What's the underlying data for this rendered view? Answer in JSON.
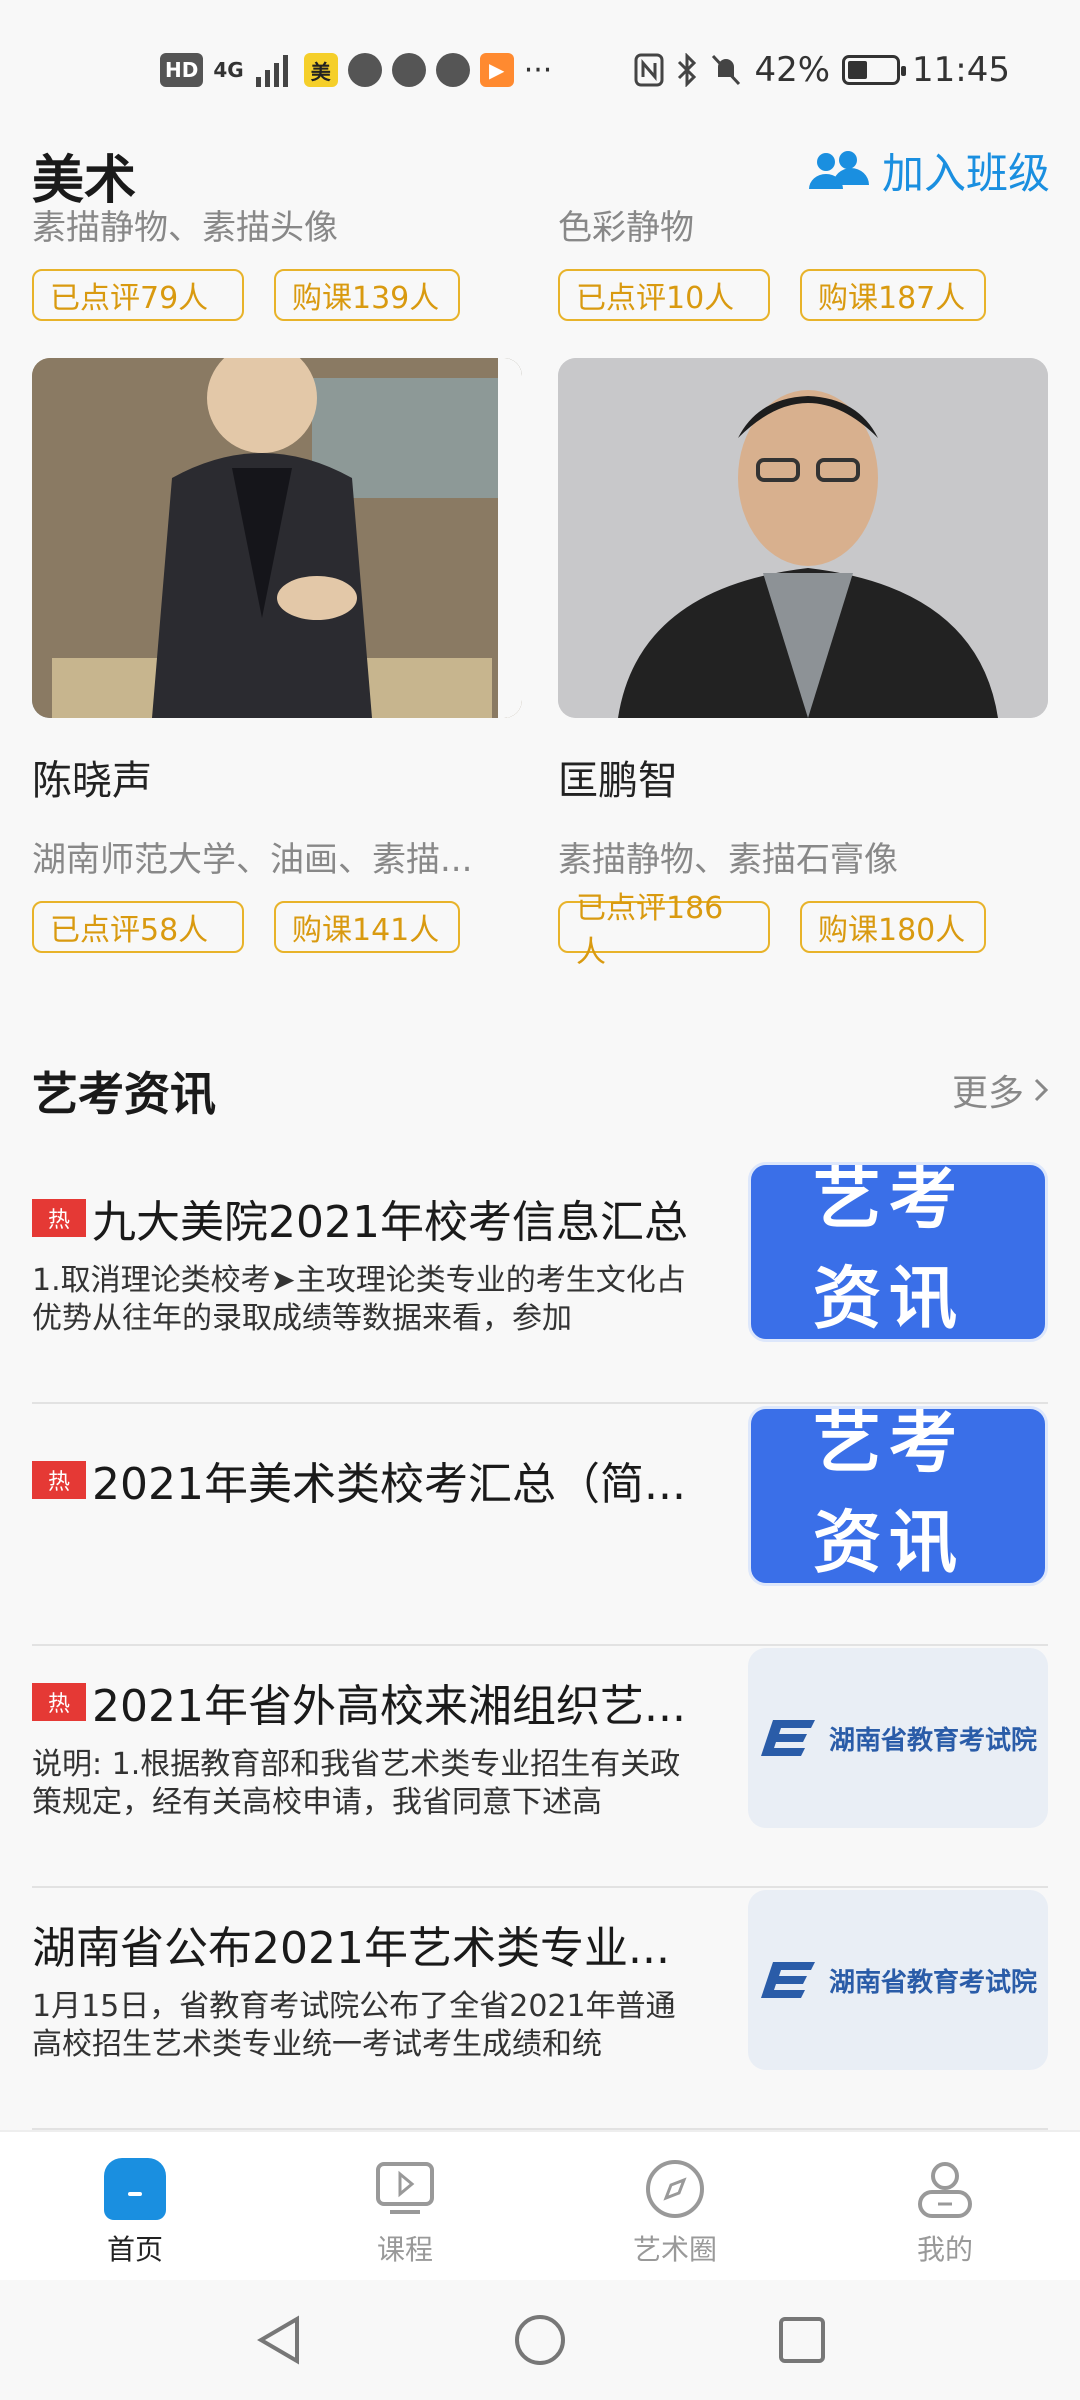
{
  "status_bar": {
    "hd": "HD",
    "net": "4G",
    "mei_app": "美",
    "more": "···",
    "battery_percent": "42%",
    "time": "11:45",
    "battery_level": 0.42
  },
  "header": {
    "section_title": "美术",
    "join_class_label": "加入班级"
  },
  "teachers": [
    {
      "name": "",
      "desc": "素描静物、素描头像",
      "reviewed": "已点评79人",
      "purchased": "购课139人"
    },
    {
      "name": "",
      "desc": "色彩静物",
      "reviewed": "已点评10人",
      "purchased": "购课187人"
    },
    {
      "name": "陈晓声",
      "desc": "湖南师范大学、油画、素描...",
      "reviewed": "已点评58人",
      "purchased": "购课141人"
    },
    {
      "name": "匡鹏智",
      "desc": "素描静物、素描石膏像",
      "reviewed": "已点评186人",
      "purchased": "购课180人"
    }
  ],
  "news": {
    "section_title": "艺考资讯",
    "more_label": "更多",
    "hot_label": "热",
    "items": [
      {
        "hot": true,
        "title": "九大美院2021年校考信息汇总",
        "summary": "1.取消理论类校考➤主攻理论类专业的考生文化占优势从往年的录取成绩等数据来看，参加",
        "thumb_line1": "艺考",
        "thumb_line2": "资讯"
      },
      {
        "hot": true,
        "title": "2021年美术类校考汇总（简...",
        "summary": "",
        "thumb_line1": "艺考",
        "thumb_line2": "资讯"
      },
      {
        "hot": true,
        "title": "2021年省外高校来湘组织艺...",
        "summary": "说明: 1.根据教育部和我省艺术类专业招生有关政策规定，经有关高校申请，我省同意下述高",
        "thumb_org": "湖南省教育考试院"
      },
      {
        "hot": false,
        "title": "湖南省公布2021年艺术类专业...",
        "summary": "1月15日，省教育考试院公布了全省2021年普通高校招生艺术类专业统一考试考生成绩和统",
        "thumb_org": "湖南省教育考试院"
      }
    ]
  },
  "bottom_nav": [
    {
      "label": "首页",
      "icon": "home-icon",
      "active": true
    },
    {
      "label": "课程",
      "icon": "video-icon",
      "active": false
    },
    {
      "label": "艺术圈",
      "icon": "compass-icon",
      "active": false
    },
    {
      "label": "我的",
      "icon": "profile-icon",
      "active": false
    }
  ],
  "colors": {
    "accent": "#1a8fe0",
    "tag_border": "#e8b32a",
    "hot_badge": "#e53935"
  }
}
